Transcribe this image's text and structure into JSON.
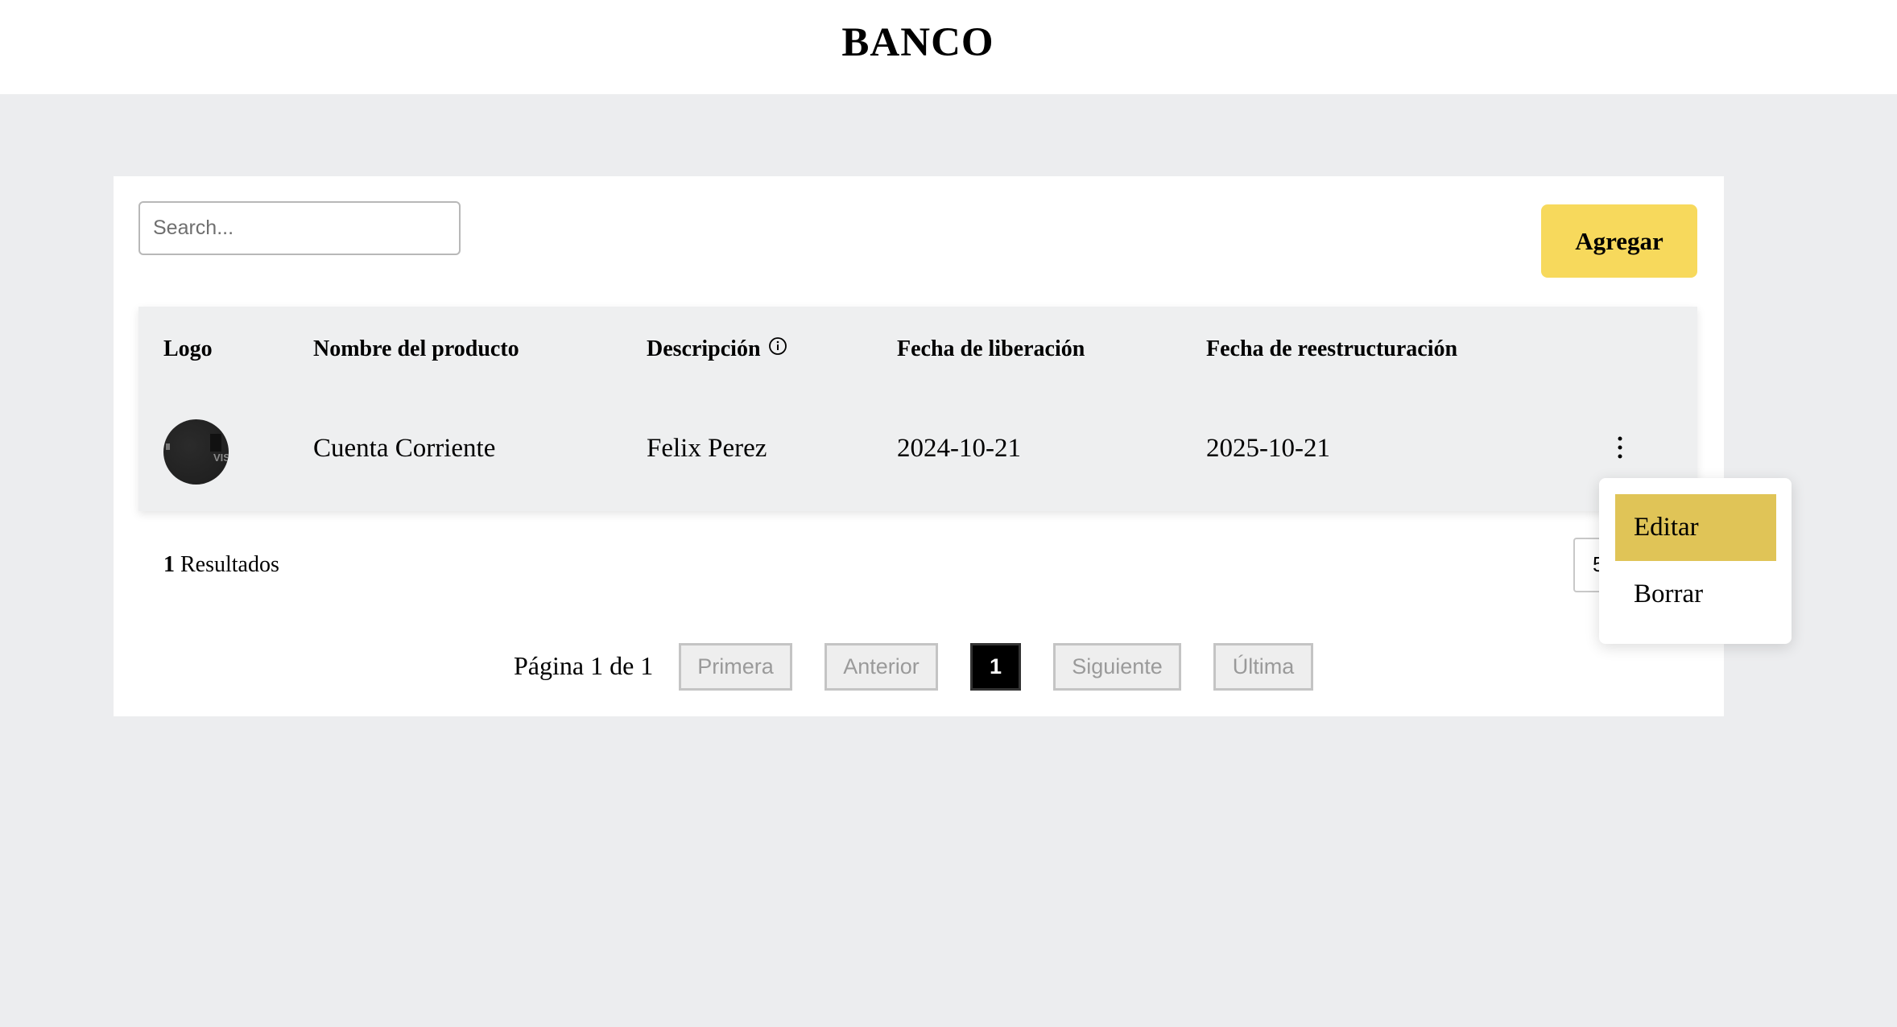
{
  "header": {
    "title": "BANCO"
  },
  "toolbar": {
    "search_placeholder": "Search...",
    "add_label": "Agregar"
  },
  "table": {
    "columns": [
      "Logo",
      "Nombre del producto",
      "Descripción",
      "Fecha de liberación",
      "Fecha de reestructuración"
    ],
    "rows": [
      {
        "logo_text": "VISA",
        "name": "Cuenta Corriente",
        "description": "Felix Perez",
        "release_date": "2024-10-21",
        "restructure_date": "2025-10-21"
      }
    ]
  },
  "footer": {
    "results_count": "1",
    "results_label": "Resultados",
    "page_size_value": "5"
  },
  "pagination": {
    "page_info": "Página 1 de 1",
    "first": "Primera",
    "prev": "Anterior",
    "current": "1",
    "next": "Siguiente",
    "last": "Última"
  },
  "row_menu": {
    "items": [
      "Editar",
      "Borrar"
    ],
    "active_index": 0
  },
  "colors": {
    "accent": "#f7d95c",
    "menu_active": "#e0c457",
    "background": "#ecedef"
  },
  "icons": {
    "info": "info-circle-icon",
    "row_actions": "kebab-menu-icon"
  }
}
